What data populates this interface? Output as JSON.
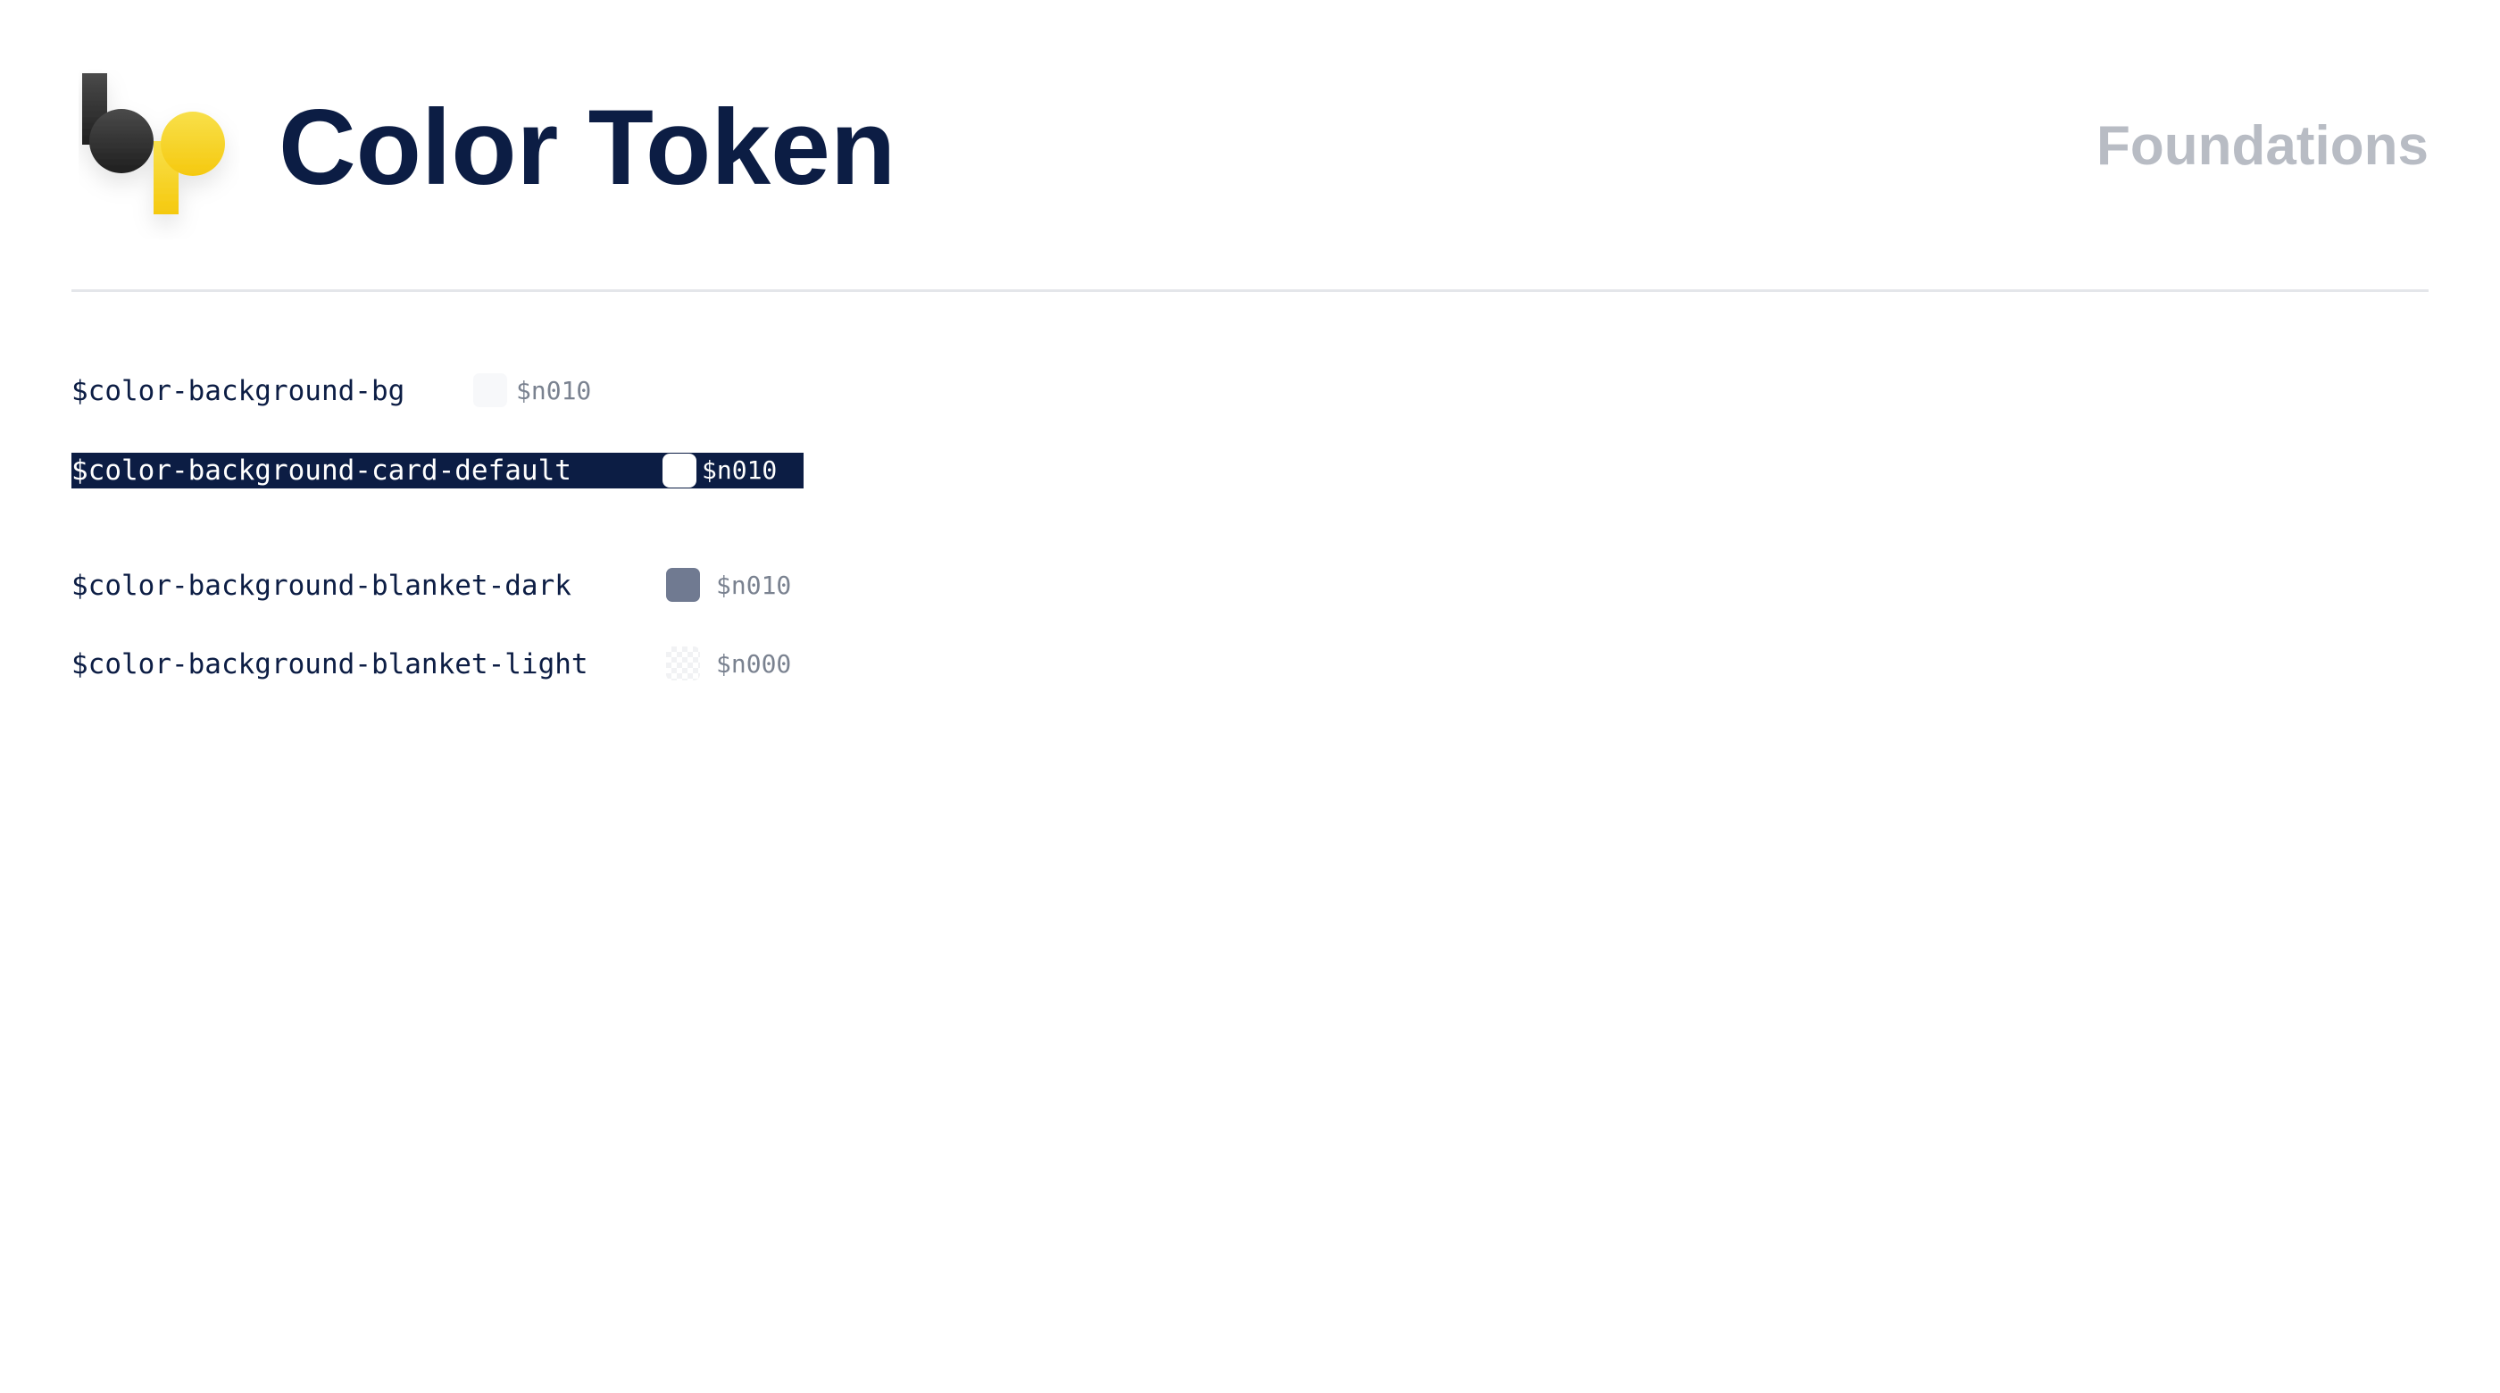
{
  "header": {
    "title": "Color Token",
    "section": "Foundations"
  },
  "logo": {
    "colors": {
      "dark": "#2b2b2b",
      "yellow": "#f7d41c"
    }
  },
  "tokens": [
    {
      "name": "$color-background-bg",
      "value": "$n010",
      "swatch": "#f7f8fa",
      "selected": false
    },
    {
      "name": "$color-background-card-default",
      "value": "$n010",
      "swatch": "#ffffff",
      "selected": true
    },
    {
      "name": "$color-background-blanket-dark",
      "value": "$n010",
      "swatch": "#707a91",
      "selected": false
    },
    {
      "name": "$color-background-blanket-light",
      "value": "$n000",
      "swatch": "checkerboard",
      "selected": false
    }
  ],
  "colors": {
    "title": "#0c1d44",
    "section": "#b8bcc4",
    "selection_bg": "#0c1d44",
    "divider": "#e4e6ea"
  }
}
